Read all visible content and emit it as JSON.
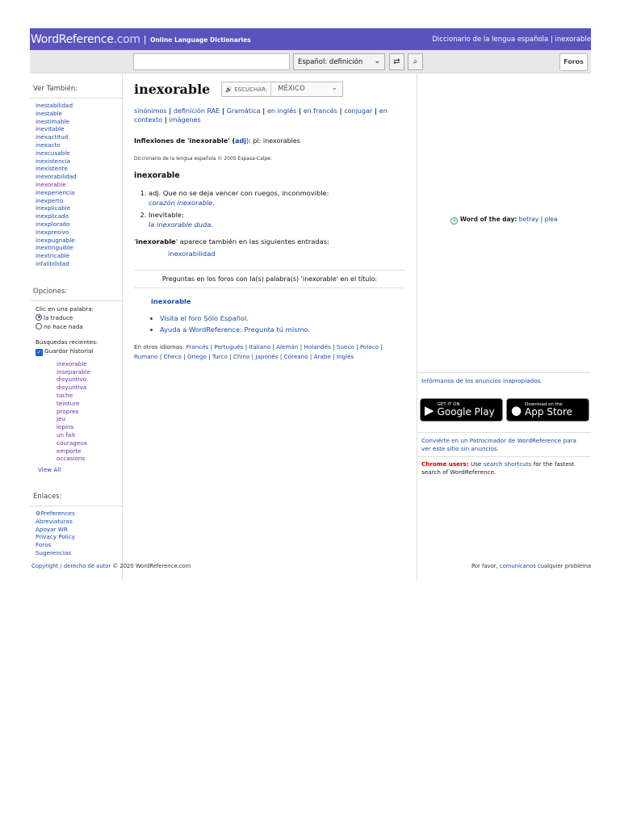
{
  "header": {
    "logo_main": "WordReference",
    "logo_com": ".com",
    "tagline_sep": "|",
    "tagline": "Online Language Dictionaries",
    "right_text": "Diccionario de la lengua española | inexorable"
  },
  "searchbar": {
    "input_value": "",
    "dict_select": "Español: definición",
    "swap_icon": "⇄",
    "search_icon": "⌕",
    "foros_label": "Foros"
  },
  "sidebar": {
    "ver_tambien_title": "Ver También:",
    "ver_tambien": [
      "inestabilidad",
      "inestable",
      "inestimable",
      "inevitable",
      "inexactitud",
      "inexacto",
      "inexcusable",
      "inexistencia",
      "inexistente",
      "inexorabilidad",
      "inexorable",
      "inexperiencia",
      "inexperto",
      "inexplicable",
      "inexplicado",
      "inexplorado",
      "inexpresivo",
      "inexpugnable",
      "inextinguible",
      "inextricable",
      "infalibilidad"
    ],
    "opciones_title": "Opciones:",
    "clic_label": "Clic en una palabra:",
    "radio1": "la traduce",
    "radio2": "no hace nada",
    "recent_label": "Búsquedas recientes:",
    "guardar": "Guardar historial",
    "recent": [
      "inexorable",
      "inseparable",
      "disyuntivo",
      "disyuntiva",
      "tache",
      "teinture",
      "propres",
      "jeu",
      "lopins",
      "un fait",
      "courageux",
      "emporte",
      "occasions"
    ],
    "view_all": "View All",
    "enlaces_title": "Enlaces:",
    "enlaces": [
      "⚙Preferences",
      "Abreviaturas",
      "Apoyar WR",
      "Privacy Policy",
      "Foros",
      "Sugerencias"
    ]
  },
  "main": {
    "headword": "inexorable",
    "listen_label": "ESCUCHAR:",
    "region": "MÉXICO",
    "links_line1": [
      {
        "t": "sinónimos"
      },
      {
        "t": "definición RAE"
      },
      {
        "t": "Gramática"
      },
      {
        "t": "en inglés"
      },
      {
        "t": "en francés"
      },
      {
        "t": "conjugar"
      },
      {
        "t": "en"
      }
    ],
    "links_line2": [
      {
        "t": "contexto"
      },
      {
        "t": "imágenes"
      }
    ],
    "infl_prefix": "Inflexiones de '",
    "infl_word": "inexorable",
    "infl_mid": "' (",
    "infl_adj": "adj",
    "infl_after": "): pl: inexorables",
    "source": "Diccionario de la lengua española © 2005 Espasa-Calpe:",
    "entry": "inexorable",
    "sense1": "adj. Que no se deja vencer con ruegos, inconmovible:",
    "sense1_ex": "corazón inexorable.",
    "sense2": "Inevitable:",
    "sense2_ex": "la inexorable duda.",
    "also_word": "inexorable",
    "also_text": "' aparece también en las siguientes entradas:",
    "also_link": "inexorabilidad",
    "forums_title": "Preguntas en los foros con la(s) palabra(s) 'inexorable' en el título:",
    "forum_word": "inexorable",
    "bullet1": "Visita el foro Sólo Español.",
    "bullet2": "Ayuda a WordReference: Pregunta tú mismo.",
    "otros_label": "En otros idiomas:",
    "otros_line1": [
      "Francés",
      "Portugués",
      "Italiano",
      "Alemán",
      "Holandés",
      "Sueco",
      "Polaco"
    ],
    "otros_line2": [
      "Rumano",
      "Checo",
      "Griego",
      "Turco",
      "Chino",
      "Japonés",
      "Coreano",
      "Árabe",
      "Inglés"
    ]
  },
  "right": {
    "wotd_label": "Word of the day:",
    "wotd1": "betray",
    "wotd_sep": "|",
    "wotd2": "plea",
    "inform": "Infórmanos de los anuncios inapropiados.",
    "gp_small": "GET IT ON",
    "gp_big": "Google Play",
    "as_small": "Download on the",
    "as_big": "App Store",
    "sponsor": "Conviérte en un Patrocinador de WordReference para ver este sitio sin anuncios.",
    "chrome_b": "Chrome users:",
    "chrome_pre": " Use ",
    "chrome_link": "search shortcuts",
    "chrome_post": " for the fastest search of WordReference."
  },
  "footer": {
    "copyright_link": "Copyright / derecho de autor",
    "copyright_text": " © 2020 WordReference.com",
    "right_pre": "Por favor, ",
    "right_link": "comunícanos",
    "right_post": " cualquier problema"
  }
}
